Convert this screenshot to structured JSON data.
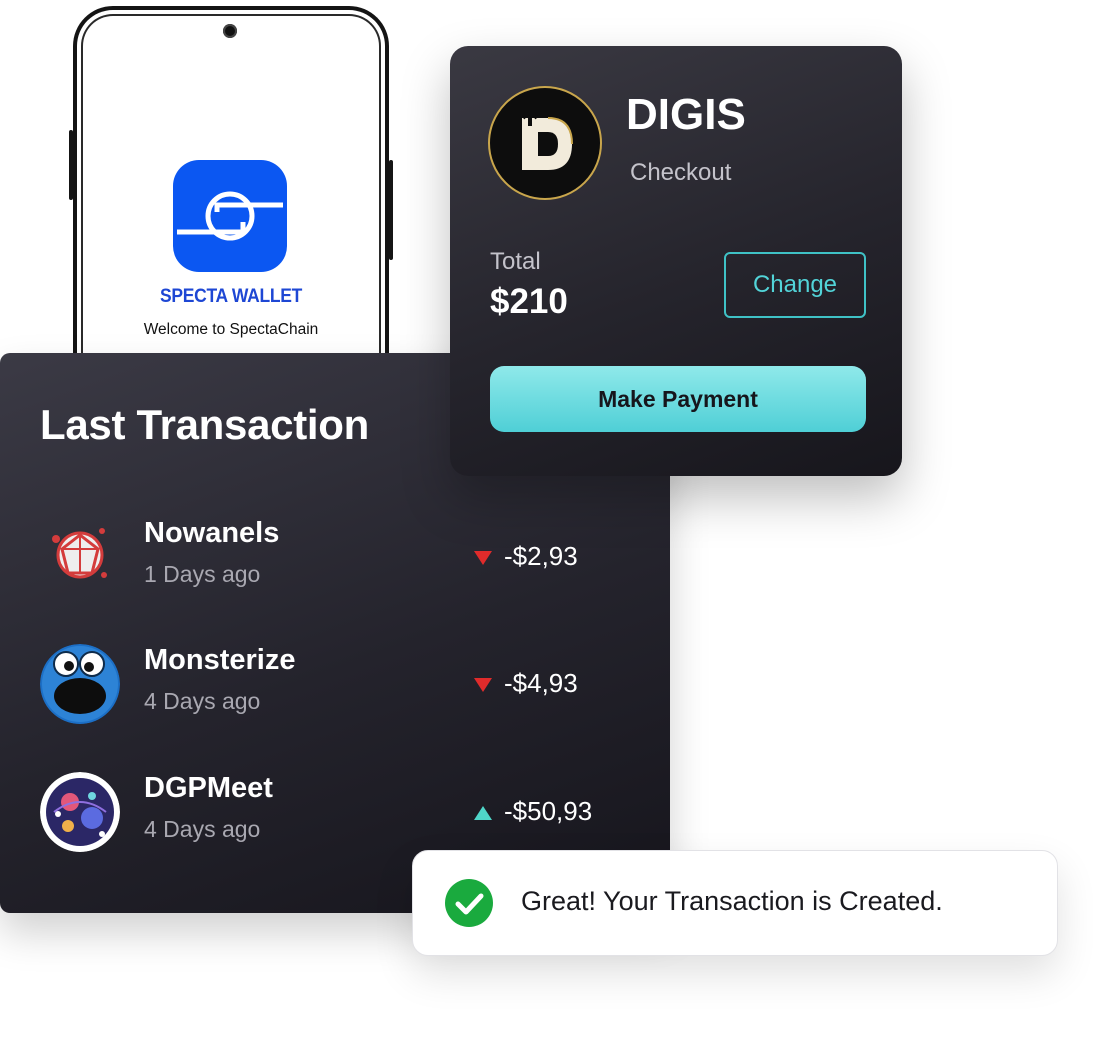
{
  "phone": {
    "app_title": "SPECTA WALLET",
    "welcome_text": "Welcome to SpectaChain"
  },
  "transactions": {
    "title": "Last Transaction",
    "items": [
      {
        "name": "Nowanels",
        "time": "1 Days ago",
        "amount": "-$2,93",
        "direction": "down",
        "icon": "geometric-sphere-avatar"
      },
      {
        "name": "Monsterize",
        "time": "4 Days ago",
        "amount": "-$4,93",
        "direction": "down",
        "icon": "cookie-monster-avatar"
      },
      {
        "name": "DGPMeet",
        "time": "4 Days ago",
        "amount": "-$50,93",
        "direction": "up",
        "icon": "cosmic-avatar"
      }
    ]
  },
  "checkout": {
    "brand": "DIGIS",
    "subtitle": "Checkout",
    "total_label": "Total",
    "total_value": "$210",
    "change_label": "Change",
    "pay_label": "Make Payment",
    "colors": {
      "accent": "#4fcfd6",
      "logo_ring": "#c9a64c"
    }
  },
  "toast": {
    "message": "Great! Your Transaction is Created.",
    "icon": "check-circle-icon",
    "color": "#1aaa3e"
  },
  "colors": {
    "down": "#e02b2b",
    "up": "#4fd6c9"
  }
}
